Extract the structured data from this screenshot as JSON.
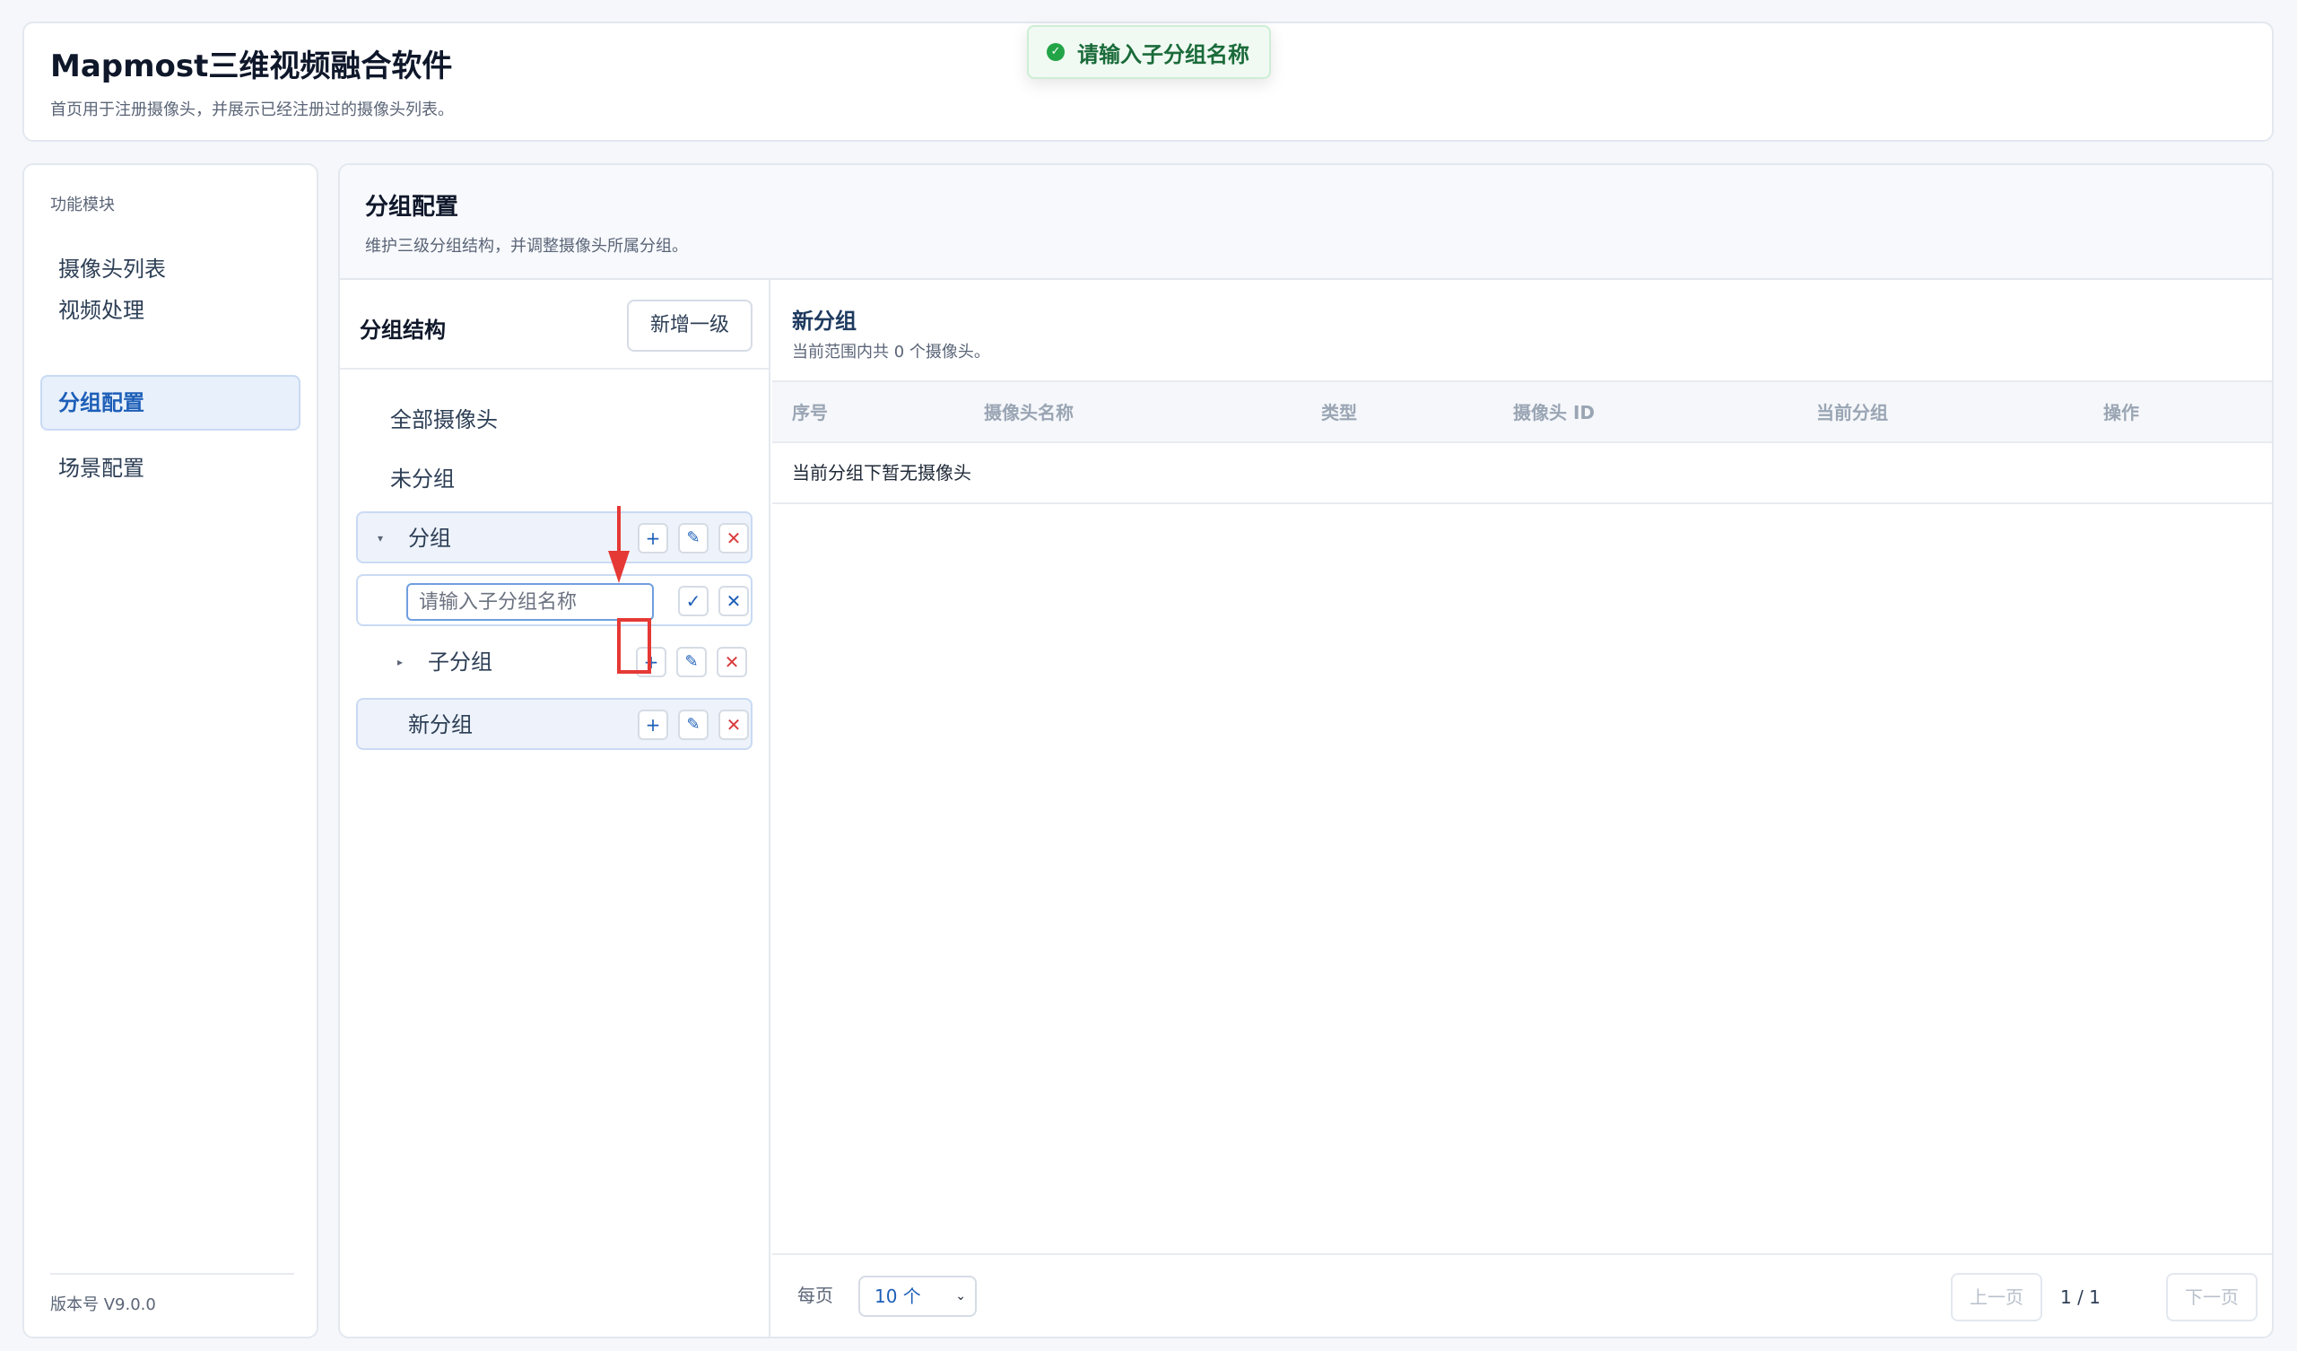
{
  "header": {
    "title": "Mapmost三维视频融合软件",
    "subtitle": "首页用于注册摄像头，并展示已经注册过的摄像头列表。"
  },
  "toast": {
    "message": "请输入子分组名称",
    "icon": "check-circle-icon",
    "color": "#22a447"
  },
  "sidebar": {
    "heading": "功能模块",
    "items": [
      {
        "label": "摄像头列表"
      },
      {
        "label": "视频处理"
      },
      {
        "label": "分组配置",
        "active": true
      },
      {
        "label": "场景配置"
      }
    ],
    "version": "版本号 V9.0.0"
  },
  "main": {
    "title": "分组配置",
    "subtitle": "维护三级分组结构，并调整摄像头所属分组。"
  },
  "tree": {
    "title": "分组结构",
    "add_root_label": "新增一级",
    "all_cameras": "全部摄像头",
    "ungrouped": "未分组",
    "group": "分组",
    "subgroup_input_placeholder": "请输入子分组名称",
    "subgroup": "子分组",
    "new_group": "新分组",
    "icons": {
      "add": "+",
      "edit": "✎",
      "delete": "✕",
      "confirm": "✓",
      "cancel": "✕",
      "caret_down": "▾",
      "caret_right": "▸"
    }
  },
  "detail": {
    "title": "新分组",
    "subtitle": "当前范围内共 0 个摄像头。",
    "columns": [
      "序号",
      "摄像头名称",
      "类型",
      "摄像头 ID",
      "当前分组",
      "操作"
    ],
    "empty_text": "当前分组下暂无摄像头"
  },
  "pager": {
    "page_size_label": "每页",
    "page_size_value": "10 个",
    "prev_label": "上一页",
    "page_indicator": "1 / 1",
    "next_label": "下一页"
  },
  "colors": {
    "accent": "#1d5fb8",
    "danger": "#d93c3c",
    "annotation": "#e53935"
  }
}
